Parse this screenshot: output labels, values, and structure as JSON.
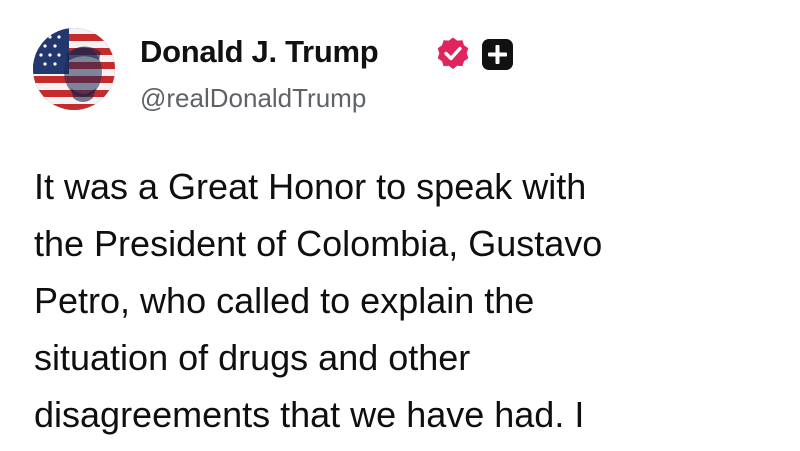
{
  "author": {
    "display_name": "Donald J. Trump",
    "handle": "@realDonaldTrump",
    "verified_badge_color": "#e0245e",
    "plus_badge_color": "#111111"
  },
  "post": {
    "lines": [
      "It was a Great Honor to speak with",
      "the President of Colombia, Gustavo",
      "Petro, who called to explain the",
      "situation of drugs and other",
      "disagreements that we have had. I"
    ]
  },
  "icons": {
    "avatar": "profile-avatar",
    "verified": "verified-badge-icon",
    "plus": "plus-badge-icon"
  }
}
